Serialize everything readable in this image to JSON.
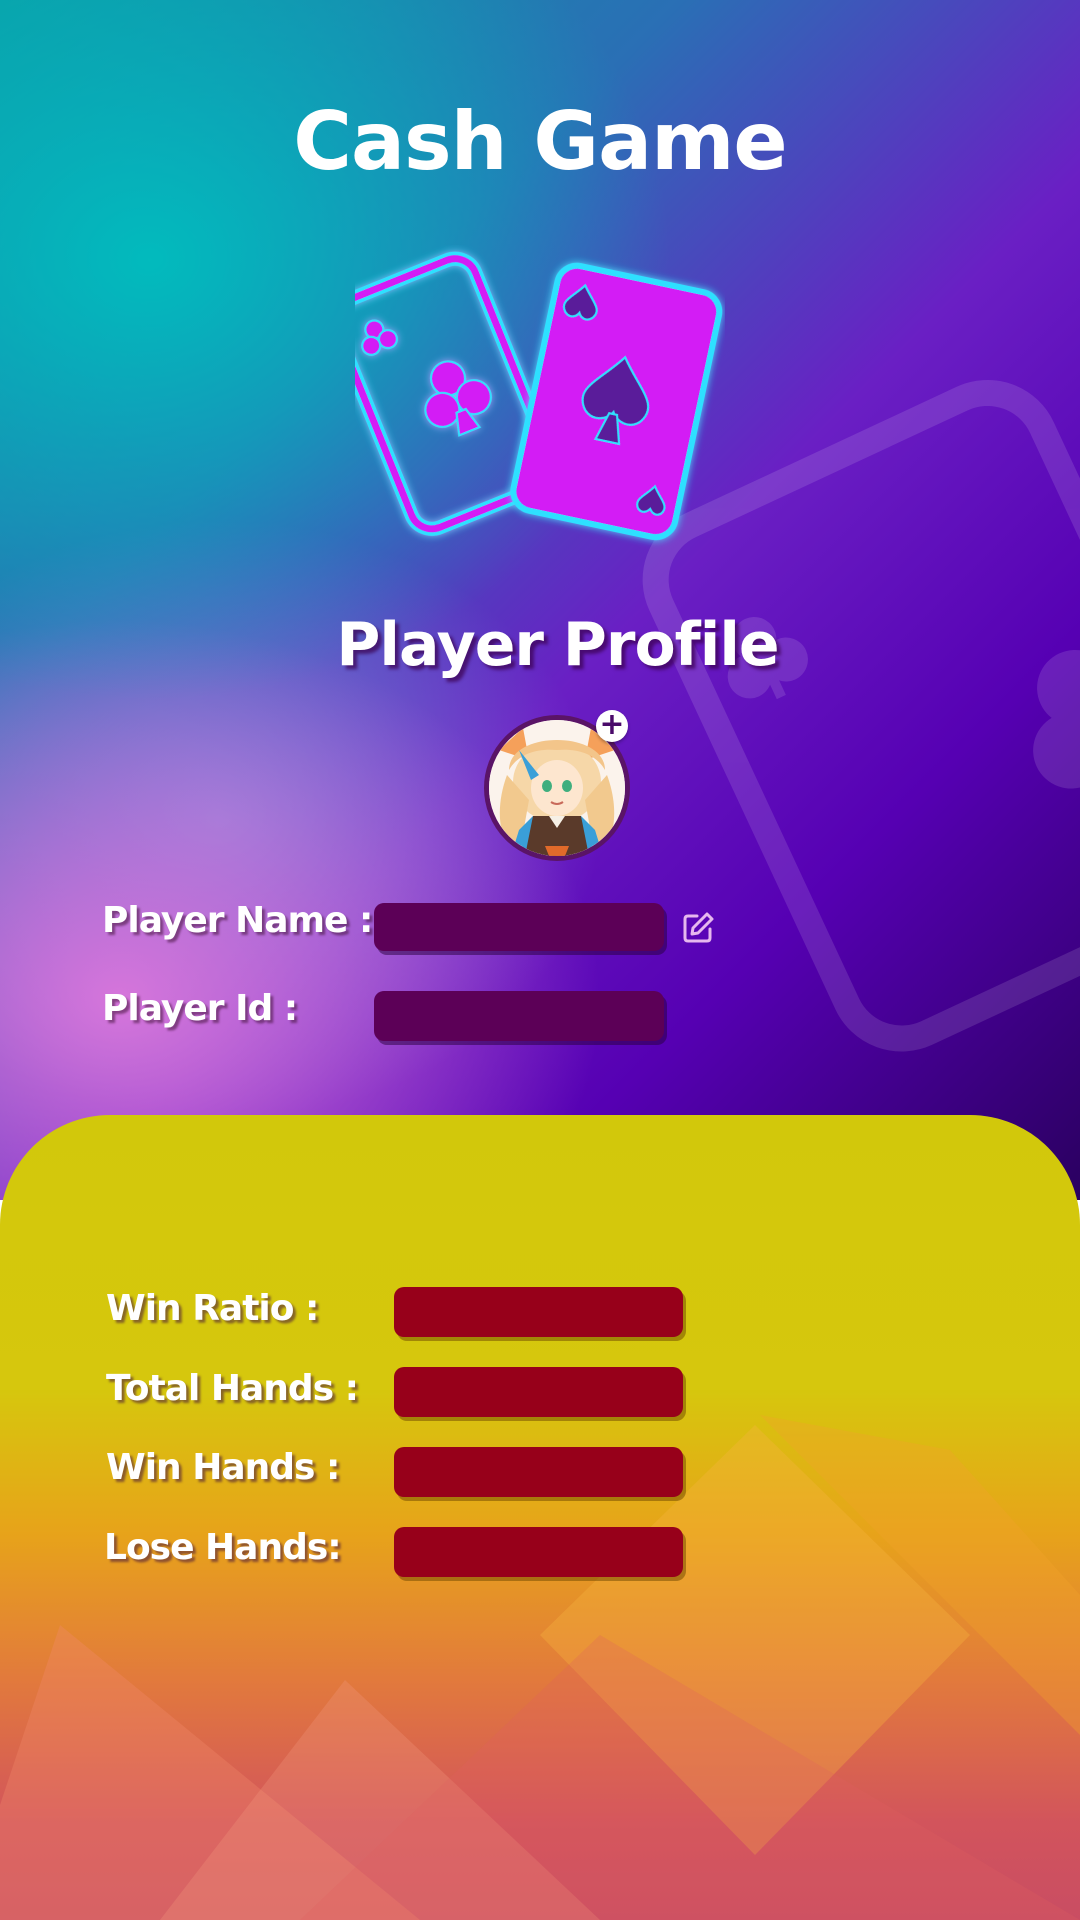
{
  "header": {
    "title": "Cash Game"
  },
  "profile": {
    "heading": "Player Profile",
    "avatar_add_symbol": "+",
    "player_name_label": "Player Name :",
    "player_name_value": "",
    "player_id_label": "Player Id :",
    "player_id_value": ""
  },
  "stats": {
    "win_ratio_label": "Win Ratio :",
    "win_ratio_value": "",
    "total_hands_label": "Total Hands :",
    "total_hands_value": "",
    "win_hands_label": "Win Hands :",
    "win_hands_value": "",
    "lose_hands_label": "Lose Hands:",
    "lose_hands_value": ""
  },
  "icons": {
    "cards": "playing-cards-icon",
    "edit": "edit-icon",
    "add": "plus-icon"
  },
  "colors": {
    "accent_cyan": "#2fe0ff",
    "card_magenta": "#d31cf5",
    "field_purple": "#5c0057",
    "field_red": "#97001a",
    "panel_yellow": "#d2c80b"
  }
}
